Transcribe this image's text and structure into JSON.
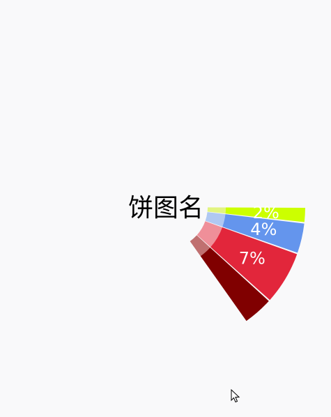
{
  "chart_data": {
    "type": "pie",
    "title": "饼图名",
    "slices": [
      {
        "label": "2%",
        "value": 2,
        "color": "#ccff00",
        "inner_color": "#e2f480"
      },
      {
        "label": "4%",
        "value": 4,
        "color": "#6495ed",
        "inner_color": "#b0c8f2"
      },
      {
        "label": "7%",
        "value": 7,
        "color": "#e2263b",
        "inner_color": "#ef8f99"
      },
      {
        "label": "",
        "value": 4,
        "color": "#800000",
        "inner_color": "#c07070"
      }
    ],
    "legend": "none",
    "grid": false
  },
  "cursor": {
    "icon": "mouse-pointer-icon"
  }
}
